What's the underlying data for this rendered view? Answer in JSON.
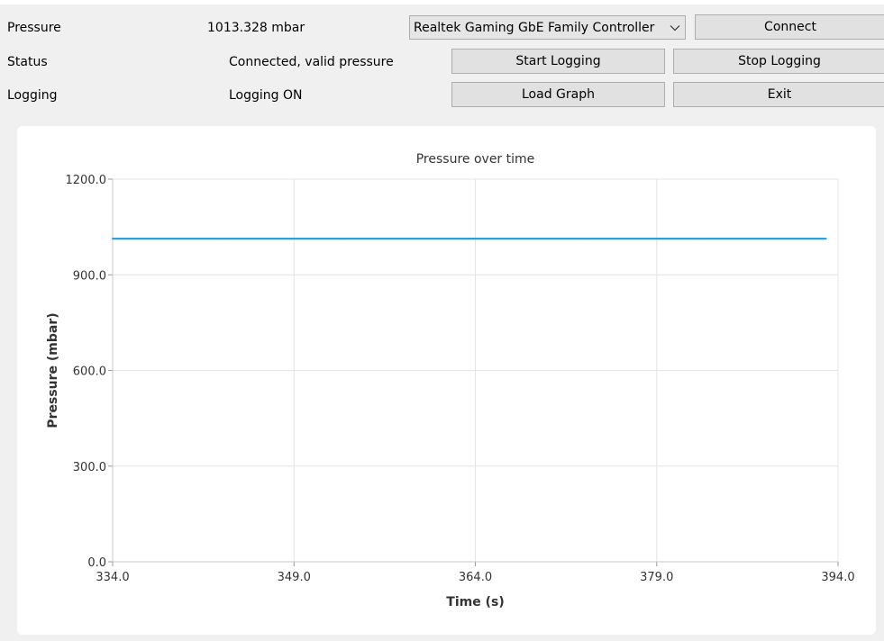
{
  "header": {
    "pressure_label": "Pressure",
    "pressure_value": "1013.328 mbar",
    "status_label": "Status",
    "status_value": "Connected, valid pressure",
    "logging_label": "Logging",
    "logging_value": "Logging ON"
  },
  "adapter_select": {
    "selected": "Realtek Gaming GbE Family Controller"
  },
  "buttons": {
    "connect": "Connect",
    "start_logging": "Start Logging",
    "stop_logging": "Stop Logging",
    "load_graph": "Load Graph",
    "exit": "Exit"
  },
  "colors": {
    "series": "#2f9fe0",
    "grid": "#e4e4e4",
    "axis": "#c8c8c8"
  },
  "chart_data": {
    "type": "line",
    "title": "Pressure over time",
    "xlabel": "Time (s)",
    "ylabel": "Pressure (mbar)",
    "xlim": [
      334.0,
      394.0
    ],
    "ylim": [
      0.0,
      1200.0
    ],
    "xticks": [
      "334.0",
      "349.0",
      "364.0",
      "379.0",
      "394.0"
    ],
    "yticks": [
      "1200.0",
      "900.0",
      "600.0",
      "300.0",
      "0.0"
    ],
    "grid": true,
    "series": [
      {
        "x": [
          334.0,
          343.0,
          353.0,
          363.0,
          373.0,
          383.0,
          393.0
        ],
        "y": [
          1013.3,
          1013.3,
          1013.3,
          1013.3,
          1013.3,
          1013.3,
          1013.3
        ]
      }
    ]
  }
}
